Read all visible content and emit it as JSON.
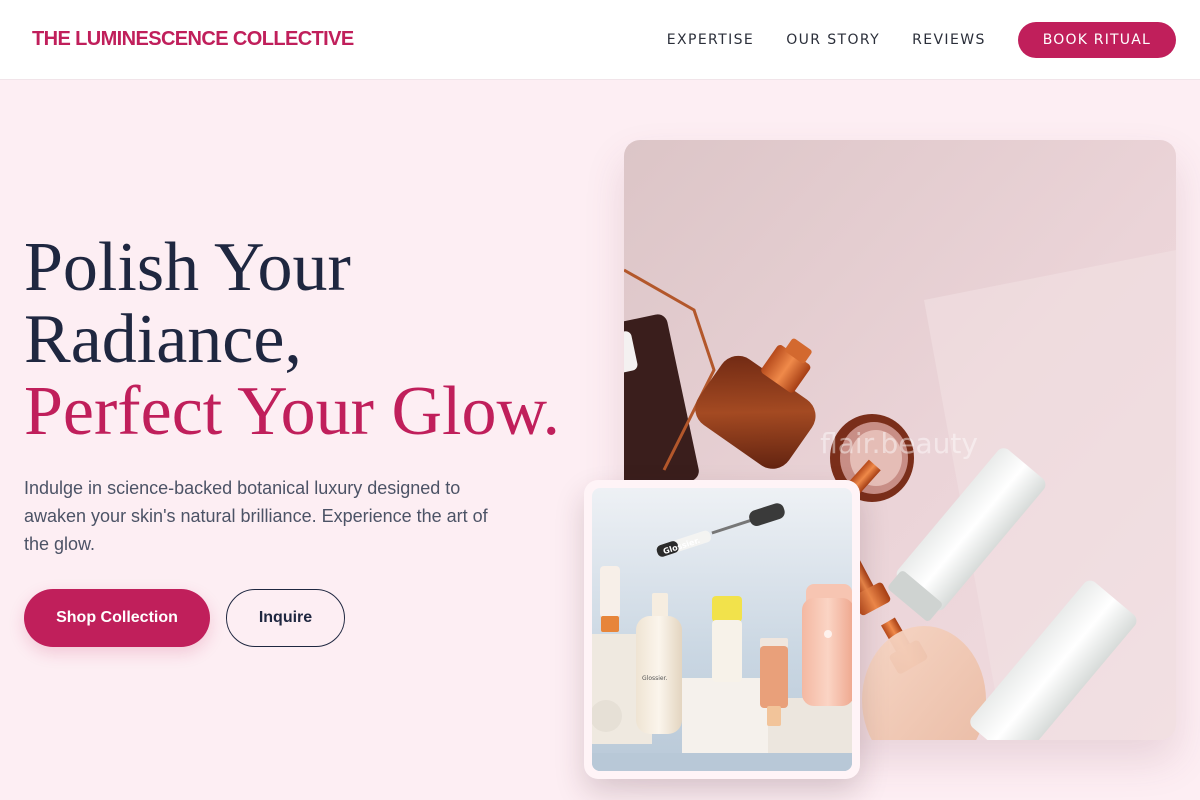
{
  "header": {
    "logo": "THE LUMINESCENCE COLLECTIVE",
    "nav": [
      "EXPERTISE",
      "OUR STORY",
      "REVIEWS"
    ],
    "cta": "BOOK RITUAL"
  },
  "hero": {
    "title_line1": "Polish Your",
    "title_line2": "Radiance,",
    "title_accent": "Perfect Your Glow.",
    "description": "Indulge in science-backed botanical luxury designed to awaken your skin's natural brilliance. Experience the art of the glow.",
    "primary_button": "Shop Collection",
    "secondary_button": "Inquire"
  },
  "images": {
    "main_watermark": "flair.beauty",
    "sub_brand": "Glossier."
  },
  "colors": {
    "accent": "#c01f5b",
    "navy": "#1f2740",
    "background": "#fdeef3"
  }
}
